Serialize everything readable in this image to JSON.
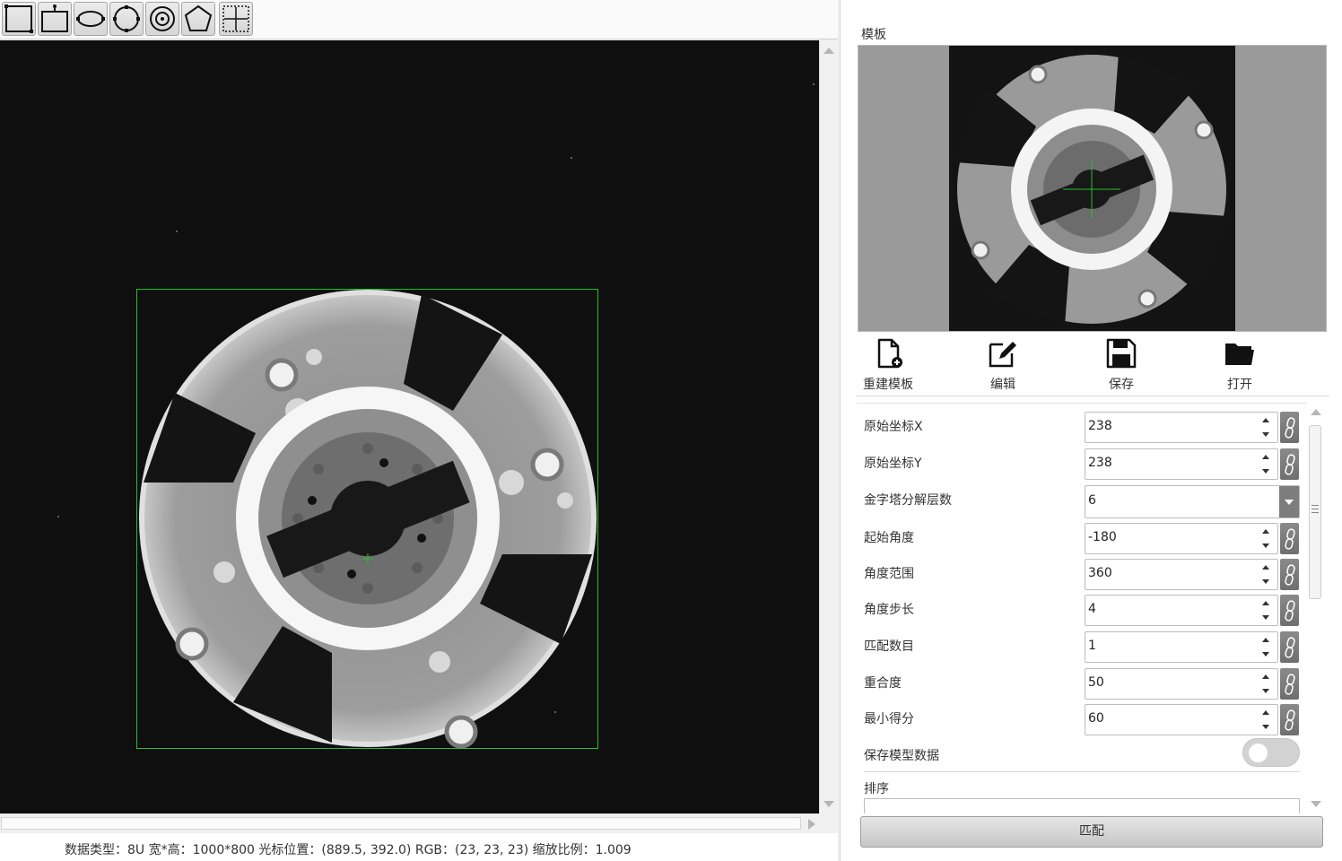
{
  "toolbar": {
    "tools": [
      {
        "icon": "rectangle-tool-icon"
      },
      {
        "icon": "rotated-rectangle-tool-icon"
      },
      {
        "icon": "ellipse-tool-icon"
      },
      {
        "icon": "circle-tool-icon"
      },
      {
        "icon": "ring-tool-icon"
      },
      {
        "icon": "polygon-tool-icon"
      },
      {
        "icon": "crosshair-grid-tool-icon"
      }
    ]
  },
  "viewer": {
    "roi_color": "#22c22a"
  },
  "status": {
    "text": "数据类型：8U 宽*高：1000*800 光标位置：(889.5, 392.0) RGB：(23, 23, 23) 缩放比例：1.009"
  },
  "panel": {
    "template_label": "模板",
    "actions": [
      {
        "label": "重建模板",
        "icon": "new-file-icon"
      },
      {
        "label": "编辑",
        "icon": "edit-icon"
      },
      {
        "label": "保存",
        "icon": "save-icon"
      },
      {
        "label": "打开",
        "icon": "folder-open-icon"
      }
    ],
    "params": [
      {
        "label": "原始坐标X",
        "value": "238",
        "kind": "spin"
      },
      {
        "label": "原始坐标Y",
        "value": "238",
        "kind": "spin"
      },
      {
        "label": "金字塔分解层数",
        "value": "6",
        "kind": "combo"
      },
      {
        "label": "起始角度",
        "value": "-180",
        "kind": "spin"
      },
      {
        "label": "角度范围",
        "value": "360",
        "kind": "spin"
      },
      {
        "label": "角度步长",
        "value": "4",
        "kind": "spin"
      },
      {
        "label": "匹配数目",
        "value": "1",
        "kind": "spin"
      },
      {
        "label": "重合度",
        "value": "50",
        "kind": "spin"
      },
      {
        "label": "最小得分",
        "value": "60",
        "kind": "spin"
      }
    ],
    "save_model_label": "保存模型数据",
    "save_model_on": false,
    "sort_label": "排序",
    "match_button": "匹配"
  }
}
